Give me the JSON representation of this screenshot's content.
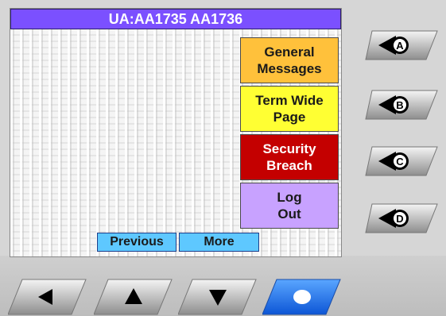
{
  "header": {
    "title": "UA:AA1735 AA1736"
  },
  "side_menu": [
    {
      "label": "General\nMessages",
      "color": "#ffc13b"
    },
    {
      "label": "Term Wide\nPage",
      "color": "#ffff33"
    },
    {
      "label": "Security\nBreach",
      "color": "#c40000"
    },
    {
      "label": "Log\nOut",
      "color": "#c8a2ff"
    }
  ],
  "paging": {
    "previous_label": "Previous",
    "more_label": "More"
  },
  "hardware": {
    "side_keys": [
      {
        "icon": "left-arrow-a-icon",
        "letter": "A"
      },
      {
        "icon": "left-arrow-b-icon",
        "letter": "B"
      },
      {
        "icon": "left-arrow-c-icon",
        "letter": "C"
      },
      {
        "icon": "left-arrow-d-icon",
        "letter": "D"
      }
    ],
    "bottom_keys": [
      {
        "icon": "left-arrow-icon"
      },
      {
        "icon": "up-arrow-icon"
      },
      {
        "icon": "down-arrow-icon"
      },
      {
        "icon": "circle-select-icon",
        "color": "#1e6eff"
      }
    ]
  }
}
